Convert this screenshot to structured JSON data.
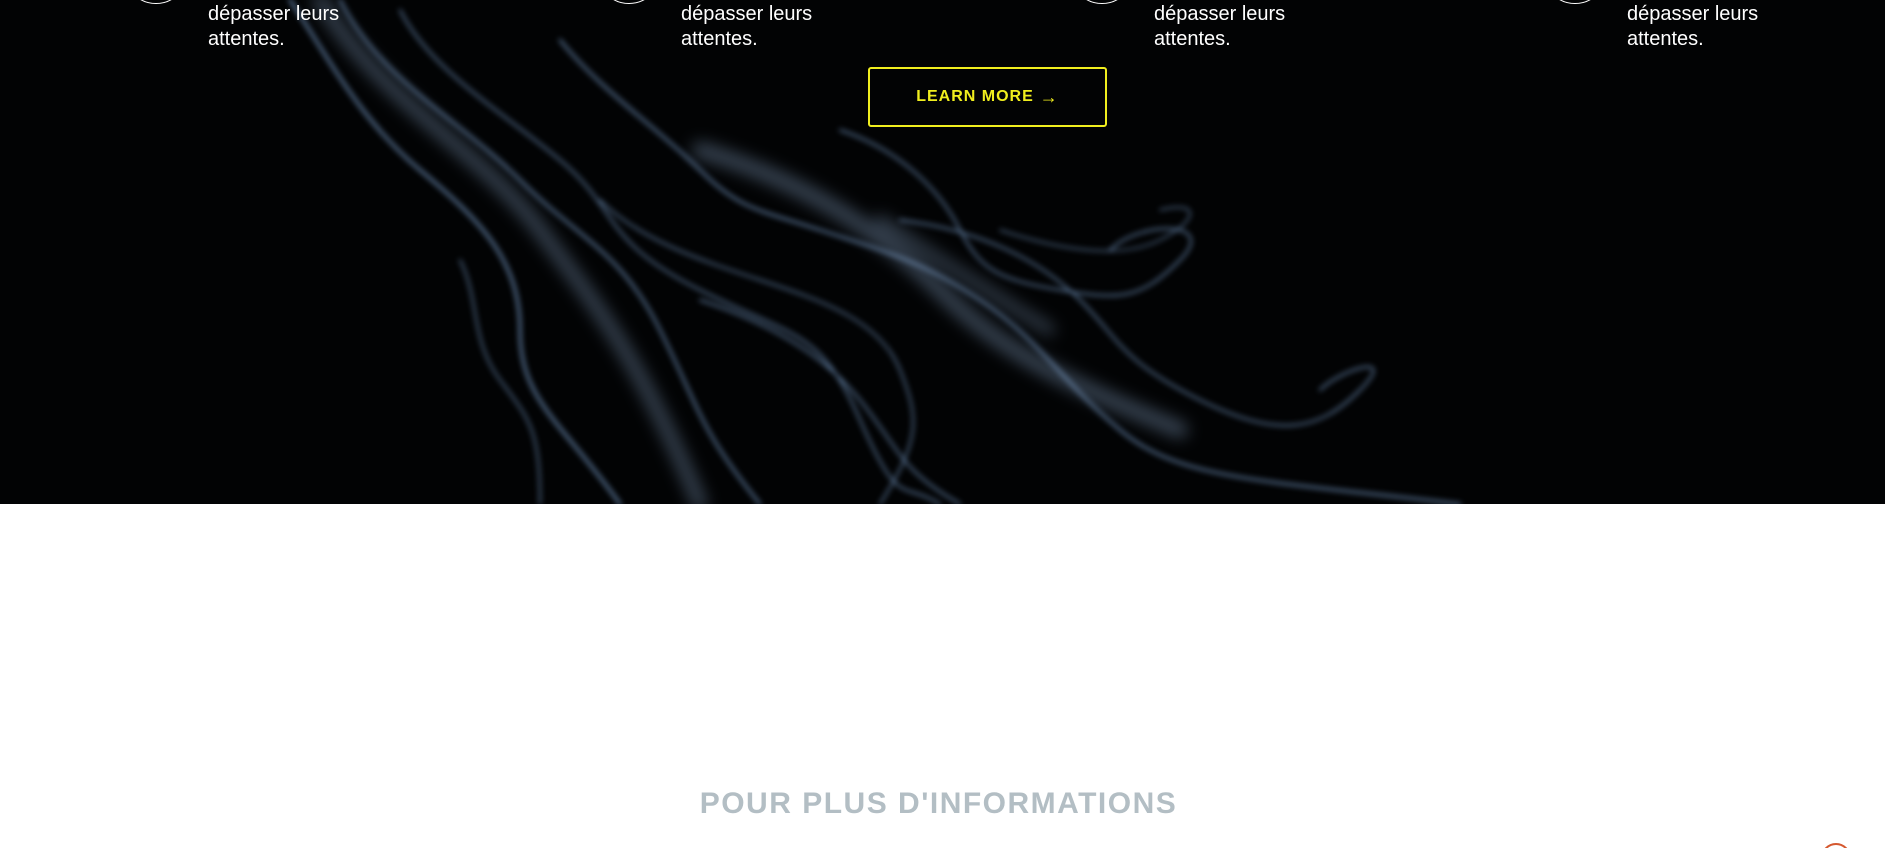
{
  "features": [
    {
      "text_line1": "dépasser leurs",
      "text_line2": "attentes."
    },
    {
      "text_line1": "dépasser leurs",
      "text_line2": "attentes."
    },
    {
      "text_line1": "dépasser leurs",
      "text_line2": "attentes."
    },
    {
      "text_line1": "dépasser leurs",
      "text_line2": "attentes."
    }
  ],
  "hero": {
    "cta_label": "LEARN MORE",
    "cta_arrow": "→",
    "accent_color": "#f0ee1e",
    "background_color": "#020304"
  },
  "info_section": {
    "heading": "POUR PLUS D'INFORMATIONS",
    "heading_color": "#b3bec4"
  },
  "icons": {
    "feature_icon": "circle-icon",
    "cta_arrow_icon": "arrow-right-icon",
    "corner_badge": "chat-badge-icon"
  }
}
